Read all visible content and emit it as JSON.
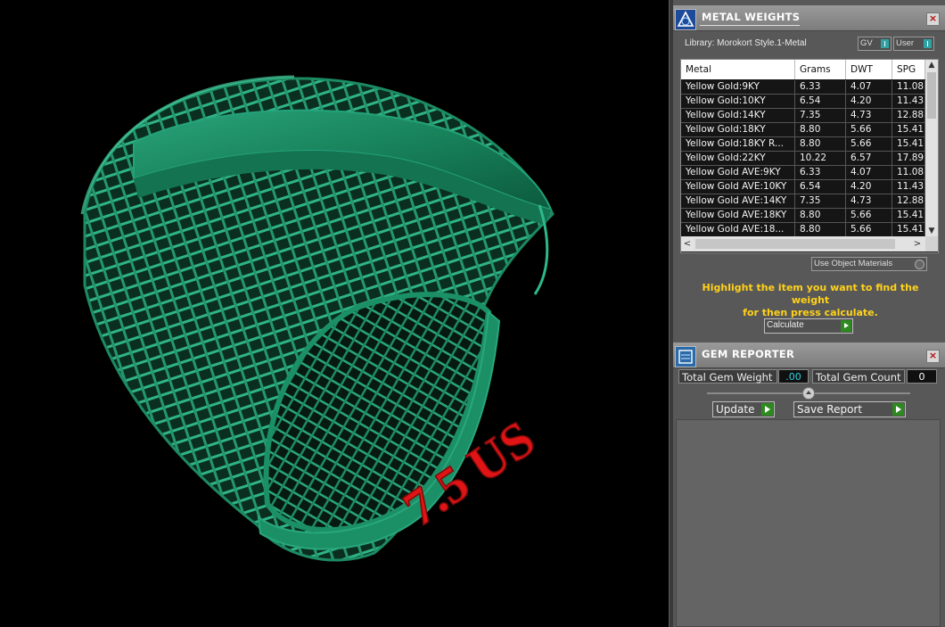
{
  "viewport": {
    "ring_size_label": "7.5 US",
    "ring_color": "#1b8f66",
    "label_color": "#e01414"
  },
  "metal_weights": {
    "title": "METAL WEIGHTS",
    "close_icon": "close-x-icon",
    "library_label": "Library: Morokort Style.1-Metal",
    "toggle_gv": "GV",
    "toggle_user": "User",
    "columns": [
      "Metal",
      "Grams",
      "DWT",
      "SPG"
    ],
    "rows": [
      [
        "Yellow Gold:9KY",
        "6.33",
        "4.07",
        "11.08"
      ],
      [
        "Yellow Gold:10KY",
        "6.54",
        "4.20",
        "11.43"
      ],
      [
        "Yellow Gold:14KY",
        "7.35",
        "4.73",
        "12.88"
      ],
      [
        "Yellow Gold:18KY",
        "8.80",
        "5.66",
        "15.41"
      ],
      [
        "Yellow Gold:18KY R...",
        "8.80",
        "5.66",
        "15.41"
      ],
      [
        "Yellow Gold:22KY",
        "10.22",
        "6.57",
        "17.89"
      ],
      [
        "Yellow Gold AVE:9KY",
        "6.33",
        "4.07",
        "11.08"
      ],
      [
        "Yellow Gold AVE:10KY",
        "6.54",
        "4.20",
        "11.43"
      ],
      [
        "Yellow Gold AVE:14KY",
        "7.35",
        "4.73",
        "12.88"
      ],
      [
        "Yellow Gold AVE:18KY",
        "8.80",
        "5.66",
        "15.41"
      ],
      [
        "Yellow Gold AVE:18...",
        "8.80",
        "5.66",
        "15.41"
      ]
    ],
    "use_object_materials": "Use Object Materials",
    "hint_line1": "Highlight the item you want to find the weight",
    "hint_line2": "for then press calculate.",
    "calculate_label": "Calculate",
    "accent_color": "#ffd21a"
  },
  "gem_reporter": {
    "title": "GEM REPORTER",
    "total_weight_label": "Total Gem Weight",
    "total_weight_value": ".00",
    "total_count_label": "Total Gem Count",
    "total_count_value": "0",
    "update_label": "Update",
    "save_report_label": "Save Report"
  }
}
